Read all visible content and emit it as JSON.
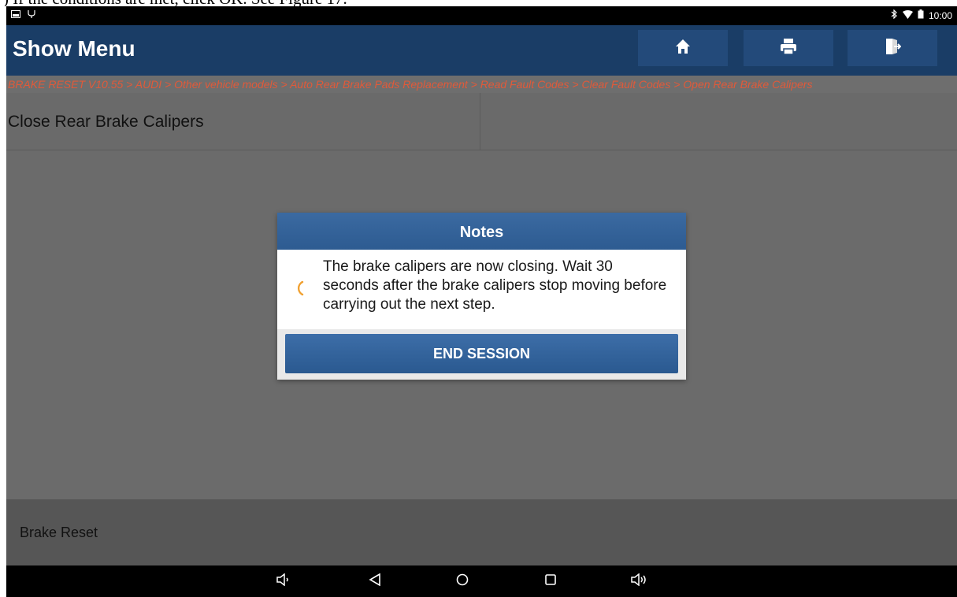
{
  "document_caption": ") If the conditions are met, click OK. See Figure 17.",
  "status_bar": {
    "time": "10:00",
    "icons": [
      "image-icon",
      "usb-icon",
      "bluetooth-icon",
      "wifi-icon",
      "battery-icon"
    ]
  },
  "header": {
    "title": "Show Menu",
    "buttons": [
      "home-icon",
      "print-icon",
      "exit-icon"
    ]
  },
  "breadcrumb": "BRAKE RESET V10.55 > AUDI > Other vehicle models > Auto Rear Brake Pads Replacement > Read Fault Codes > Clear Fault Codes > Open Rear Brake Calipers",
  "page": {
    "title": "Close Rear Brake Calipers"
  },
  "dialog": {
    "title": "Notes",
    "message": "The brake calipers are now closing. Wait 30 seconds after the brake calipers stop moving before carrying out the next step.",
    "button_label": "END SESSION",
    "spinner_icon": "loading-spinner-icon"
  },
  "footer": {
    "label": "Brake Reset"
  },
  "nav_bar": {
    "buttons": [
      "volume-down-icon",
      "back-icon",
      "home-circle-icon",
      "recents-icon",
      "volume-up-icon"
    ]
  },
  "colors": {
    "title_bar": "#1a3d66",
    "breadcrumb_text": "#e05a3a",
    "dialog_header": "#2d5b91",
    "spinner": "#f0a030"
  }
}
